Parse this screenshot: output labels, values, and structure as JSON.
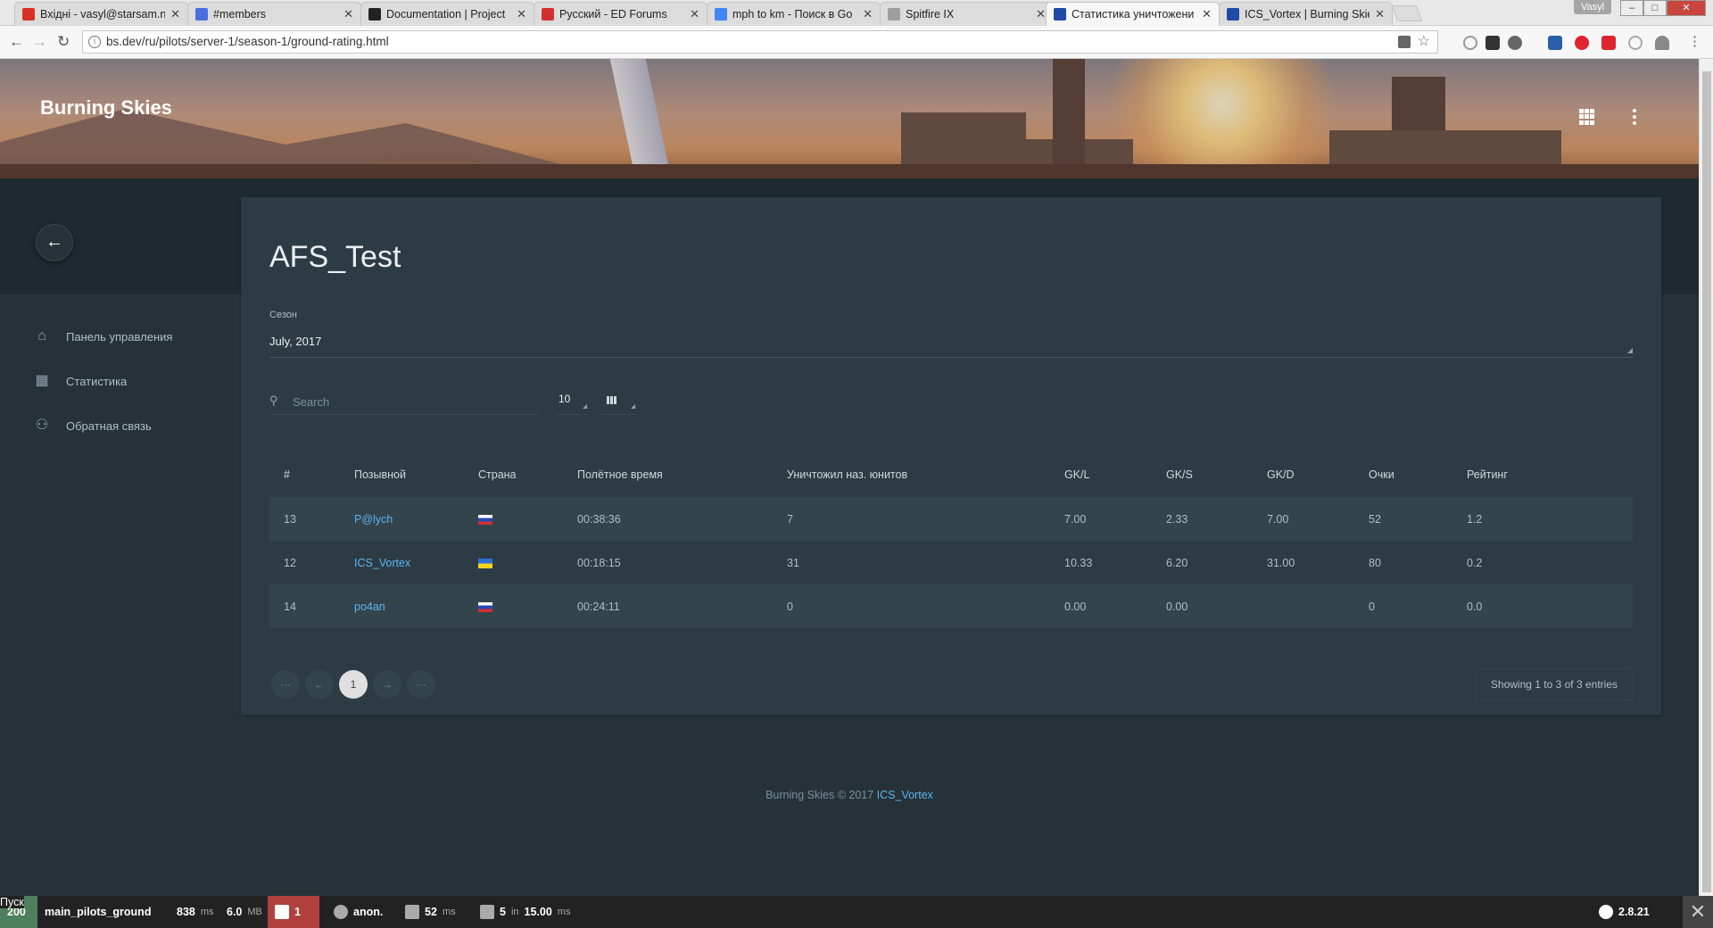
{
  "browser": {
    "tabs": [
      {
        "title": "Вхідні - vasyl@starsam.n",
        "color": "#d93025"
      },
      {
        "title": "#members",
        "color": "#4a6ee0"
      },
      {
        "title": "Documentation | Project",
        "color": "#222222"
      },
      {
        "title": "Русский - ED Forums",
        "color": "#d32f2f"
      },
      {
        "title": "mph to km - Поиск в Go",
        "color": "#4285f4"
      },
      {
        "title": "Spitfire IX",
        "color": "#9e9e9e"
      },
      {
        "title": "Статистика уничтожени",
        "color": "#1f4aa8"
      },
      {
        "title": "ICS_Vortex | Burning Skie",
        "color": "#1f4aa8"
      }
    ],
    "user": "Vasyl",
    "url": "bs.dev/ru/pilots/server-1/season-1/ground-rating.html"
  },
  "header": {
    "brand": "Burning Skies"
  },
  "sidebar": {
    "items": [
      {
        "label": "Панель управления",
        "icon": "home-icon"
      },
      {
        "label": "Статистика",
        "icon": "bar-chart-icon"
      },
      {
        "label": "Обратная связь",
        "icon": "people-icon"
      }
    ]
  },
  "main": {
    "title": "AFS_Test",
    "season_label": "Сезон",
    "season_value": "July, 2017",
    "search_placeholder": "Search",
    "per_page": "10",
    "table": {
      "headers": [
        "#",
        "Позывной",
        "Страна",
        "Полётное время",
        "Уничтожил наз. юнитов",
        "GK/L",
        "GK/S",
        "GK/D",
        "Очки",
        "Рейтинг"
      ],
      "rows": [
        {
          "rank": "13",
          "callsign": "P@lych",
          "country": "ru",
          "time": "00:38:36",
          "destroyed": "7",
          "gkl": "7.00",
          "gks": "2.33",
          "gkd": "7.00",
          "points": "52",
          "rating": "1.2"
        },
        {
          "rank": "12",
          "callsign": "ICS_Vortex",
          "country": "ua",
          "time": "00:18:15",
          "destroyed": "31",
          "gkl": "10.33",
          "gks": "6.20",
          "gkd": "31.00",
          "points": "80",
          "rating": "0.2"
        },
        {
          "rank": "14",
          "callsign": "po4an",
          "country": "ru",
          "time": "00:24:11",
          "destroyed": "0",
          "gkl": "0.00",
          "gks": "0.00",
          "gkd": "",
          "points": "0",
          "rating": "0.0"
        }
      ]
    },
    "pagination": {
      "first": "···",
      "prev": "←",
      "current": "1",
      "next": "→",
      "last": "···"
    },
    "showing": "Showing 1 to 3 of 3 entries"
  },
  "footer": {
    "text": "Burning Skies © 2017",
    "link": "ICS_Vortex"
  },
  "toolbar": {
    "status": "200",
    "route": "main_pilots_ground",
    "time": "838",
    "time_unit": "ms",
    "memory": "6.0",
    "memory_unit": "MB",
    "logs": "1",
    "user": "anon.",
    "twig_time": "52",
    "twig_unit": "ms",
    "db_queries": "5",
    "db_in": "in",
    "db_time": "15.00",
    "db_unit": "ms",
    "version": "2.8.21",
    "tooltip": "Пуск"
  }
}
